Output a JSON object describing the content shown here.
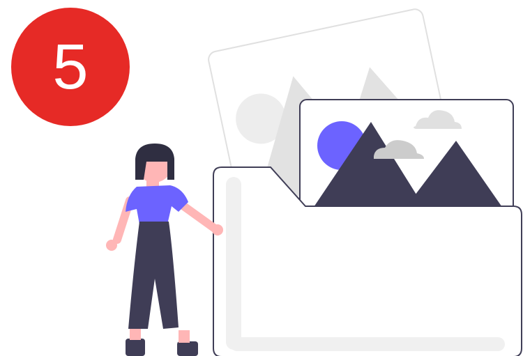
{
  "badge": {
    "number": "5",
    "color": "#e62a26"
  },
  "colors": {
    "accent_purple": "#6c63ff",
    "mountain_dark": "#3f3d56",
    "back_photo_gray": "#e6e6e6",
    "cloud_gray": "#cccccc",
    "outline": "#3f3d56",
    "skin": "#ffb6b6",
    "folder_fill": "#ffffff",
    "folder_inner": "#f2f2f2"
  },
  "illustration": {
    "subject": "woman-opening-image-folder",
    "icons": [
      "image-folder-icon",
      "photo-icon",
      "mountain-icon",
      "sun-icon",
      "cloud-icon"
    ]
  }
}
